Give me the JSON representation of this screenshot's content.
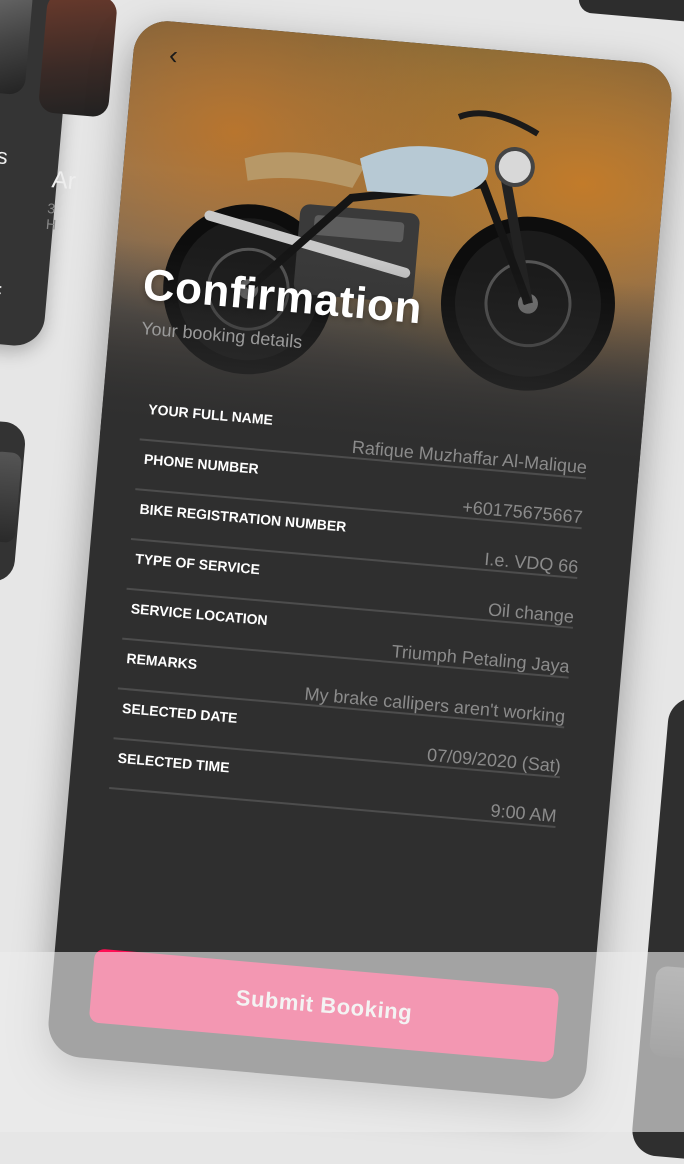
{
  "colors": {
    "background": "#e6e6e6",
    "card": "#2f2f2f",
    "accent": "#ff0f55",
    "label": "#ffffff",
    "value": "#8b8b8b",
    "divider": "#4d4d4d"
  },
  "background_cards": {
    "left_title_fragment": "s",
    "left_card_title": "Ar",
    "left_card_sub": "3 H"
  },
  "header": {
    "back_icon": "chevron-left-icon",
    "back_glyph": "‹",
    "title": "Confirmation",
    "subtitle": "Your booking details"
  },
  "hero": {
    "image": "motorcycle-photo"
  },
  "fields": [
    {
      "label": "Your Full Name",
      "value": "Rafique Muzhaffar Al-Malique"
    },
    {
      "label": "Phone Number",
      "value": "+60175675667"
    },
    {
      "label": "Bike Registration Number",
      "value": "I.e. VDQ 66"
    },
    {
      "label": "Type of Service",
      "value": "Oil change"
    },
    {
      "label": "Service Location",
      "value": "Triumph Petaling Jaya"
    },
    {
      "label": "Remarks",
      "value": "My brake callipers aren't working"
    },
    {
      "label": "Selected Date",
      "value": "07/09/2020 (Sat)"
    },
    {
      "label": "Selected Time",
      "value": "9:00 AM"
    }
  ],
  "actions": {
    "submit_label": "Submit Booking"
  }
}
